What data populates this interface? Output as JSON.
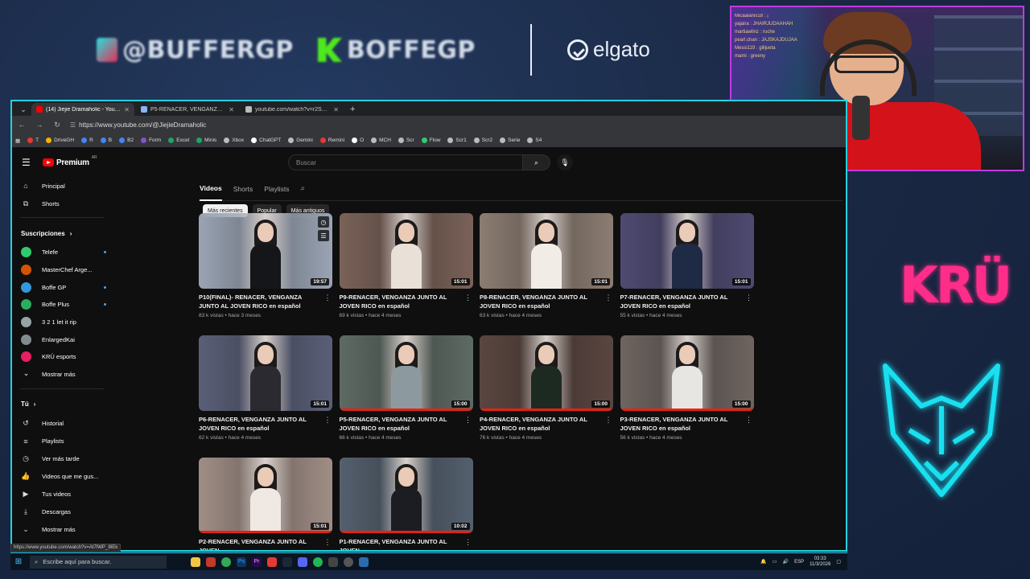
{
  "overlay": {
    "tiktok_handle": "@BUFFERGP",
    "kick_handle": "BOFFEGP",
    "sponsor": "elgato",
    "team_logo": "KRÜ",
    "webcam_chat": [
      "Micaalanis18 : ¡",
      "yajaira : JHAIRJUDAAHAH",
      "martiawlinz : ruche",
      "pearl.chan : JAJSKAJDUJAA",
      "Messi119 : gilijueta",
      "mami : greeny"
    ]
  },
  "browser": {
    "tabs": [
      {
        "label": "(14) Jiejie Dramaholic - YouTube",
        "active": true,
        "favicon": "youtube-icon",
        "color": "#ff0000"
      },
      {
        "label": "P5-RENACER, VENGANZA JUNTO",
        "active": false,
        "favicon": "tab-icon",
        "color": "#8ab4f8"
      },
      {
        "label": "youtube.com/watch?v=r2Sa1v",
        "active": false,
        "favicon": "globe-icon",
        "color": "#bbbbbb"
      }
    ],
    "url": "https://www.youtube.com/@JiejieDramaholic",
    "bookmarks": [
      {
        "label": "T",
        "color": "#e53935"
      },
      {
        "label": "DriveGH",
        "color": "#f4b400"
      },
      {
        "label": "R",
        "color": "#4285f4"
      },
      {
        "label": "B",
        "color": "#4285f4"
      },
      {
        "label": "B2",
        "color": "#4285f4"
      },
      {
        "label": "Form",
        "color": "#7e57c2"
      },
      {
        "label": "Excel",
        "color": "#21a366"
      },
      {
        "label": "Minis",
        "color": "#21a366"
      },
      {
        "label": "Xbox",
        "color": "#bbbbbb"
      },
      {
        "label": "ChatGPT",
        "color": "#ffffff"
      },
      {
        "label": "Gemini",
        "color": "#bbbbbb"
      },
      {
        "label": "Remini",
        "color": "#e53935"
      },
      {
        "label": "O",
        "color": "#ffffff"
      },
      {
        "label": "MCH",
        "color": "#bbbbbb"
      },
      {
        "label": "Scr",
        "color": "#bbbbbb"
      },
      {
        "label": "Flow",
        "color": "#2ecc71"
      },
      {
        "label": "Scr1",
        "color": "#bbbbbb"
      },
      {
        "label": "Scr2",
        "color": "#bbbbbb"
      },
      {
        "label": "Serie",
        "color": "#bbbbbb"
      },
      {
        "label": "S4",
        "color": "#bbbbbb"
      }
    ],
    "status_url": "https://www.youtube.com/watch?v=At7lWP_I8Ek"
  },
  "youtube": {
    "brand": "Premium",
    "country": "AR",
    "search_placeholder": "Buscar",
    "sidebar": {
      "main": [
        {
          "label": "Principal",
          "icon": "home-icon"
        },
        {
          "label": "Shorts",
          "icon": "shorts-icon"
        }
      ],
      "subs_title": "Suscripciones",
      "subs": [
        {
          "label": "Telefe",
          "color": "#2ecc71",
          "dot": true
        },
        {
          "label": "MasterChef Arge...",
          "color": "#d35400",
          "dot": false
        },
        {
          "label": "Boffe GP",
          "color": "#3498db",
          "dot": true
        },
        {
          "label": "Boffe Plus",
          "color": "#27ae60",
          "dot": true
        },
        {
          "label": "3 2 1 let it rip",
          "color": "#95a5a6",
          "dot": false
        },
        {
          "label": "EnlargedKai",
          "color": "#7f8c8d",
          "dot": false
        },
        {
          "label": "KRÜ esports",
          "color": "#e91e63",
          "dot": false
        },
        {
          "label": "Mostrar más",
          "color": "",
          "dot": false
        }
      ],
      "you_title": "Tú",
      "you": [
        {
          "label": "Historial",
          "icon": "history-icon"
        },
        {
          "label": "Playlists",
          "icon": "playlists-icon"
        },
        {
          "label": "Ver más tarde",
          "icon": "watch-later-icon"
        },
        {
          "label": "Videos que me gus...",
          "icon": "like-icon"
        },
        {
          "label": "Tus videos",
          "icon": "your-videos-icon"
        },
        {
          "label": "Descargas",
          "icon": "download-icon"
        },
        {
          "label": "Mostrar más",
          "icon": "chevron-down-icon"
        }
      ]
    },
    "channel_tabs": [
      "Videos",
      "Shorts",
      "Playlists"
    ],
    "chips": [
      "Más recientes",
      "Popular",
      "Más antiguos"
    ],
    "videos": [
      {
        "title": "P10(FINAL)- RENACER, VENGANZA JUNTO AL JOVEN RICO en español",
        "stats": "83 k vistas • hace 3 meses",
        "duration": "19:57",
        "bg": "#9aa4b4",
        "dress": "#15161a",
        "progress": false
      },
      {
        "title": "P9-RENACER, VENGANZA JUNTO AL JOVEN RICO en español",
        "stats": "69 k vistas • hace 4 meses",
        "duration": "15:01",
        "bg": "#7a6258",
        "dress": "#e9e0d8",
        "progress": false
      },
      {
        "title": "P8-RENACER, VENGANZA JUNTO AL JOVEN RICO en español",
        "stats": "63 k vistas • hace 4 meses",
        "duration": "15:01",
        "bg": "#8c7d72",
        "dress": "#f2ece6",
        "progress": false
      },
      {
        "title": "P7-RENACER, VENGANZA JUNTO AL JOVEN RICO en español",
        "stats": "55 k vistas • hace 4 meses",
        "duration": "15:01",
        "bg": "#4e4a72",
        "dress": "#1f2a44",
        "progress": false
      },
      {
        "title": "P6-RENACER, VENGANZA JUNTO AL JOVEN RICO en español",
        "stats": "62 k vistas • hace 4 meses",
        "duration": "15:01",
        "bg": "#5a5f78",
        "dress": "#2a2a30",
        "progress": false
      },
      {
        "title": "P5-RENACER, VENGANZA JUNTO AL JOVEN RICO en español",
        "stats": "66 k vistas • hace 4 meses",
        "duration": "15:00",
        "bg": "#5e6a64",
        "dress": "#8c9aa0",
        "progress": true
      },
      {
        "title": "P4-RENACER, VENGANZA JUNTO AL JOVEN RICO en español",
        "stats": "76 k vistas • hace 4 meses",
        "duration": "15:00",
        "bg": "#5a4640",
        "dress": "#1c2a22",
        "progress": true
      },
      {
        "title": "P3-RENACER, VENGANZA JUNTO AL JOVEN RICO en español",
        "stats": "56 k vistas • hace 4 meses",
        "duration": "15:00",
        "bg": "#6e6560",
        "dress": "#e8e6e2",
        "progress": true
      },
      {
        "title": "P2-RENACER, VENGANZA JUNTO AL JOVEN",
        "stats": "",
        "duration": "15:01",
        "bg": "#a08e86",
        "dress": "#f0e8e2",
        "progress": true
      },
      {
        "title": "P1-RENACER, VENGANZA JUNTO AL JOVEN",
        "stats": "",
        "duration": "10:02",
        "bg": "#54606e",
        "dress": "#1b1d22",
        "progress": true
      }
    ]
  },
  "taskbar": {
    "search_placeholder": "Escribe aquí para buscar.",
    "lang": "ESP",
    "time": "03:33",
    "date": "11/3/2026"
  }
}
